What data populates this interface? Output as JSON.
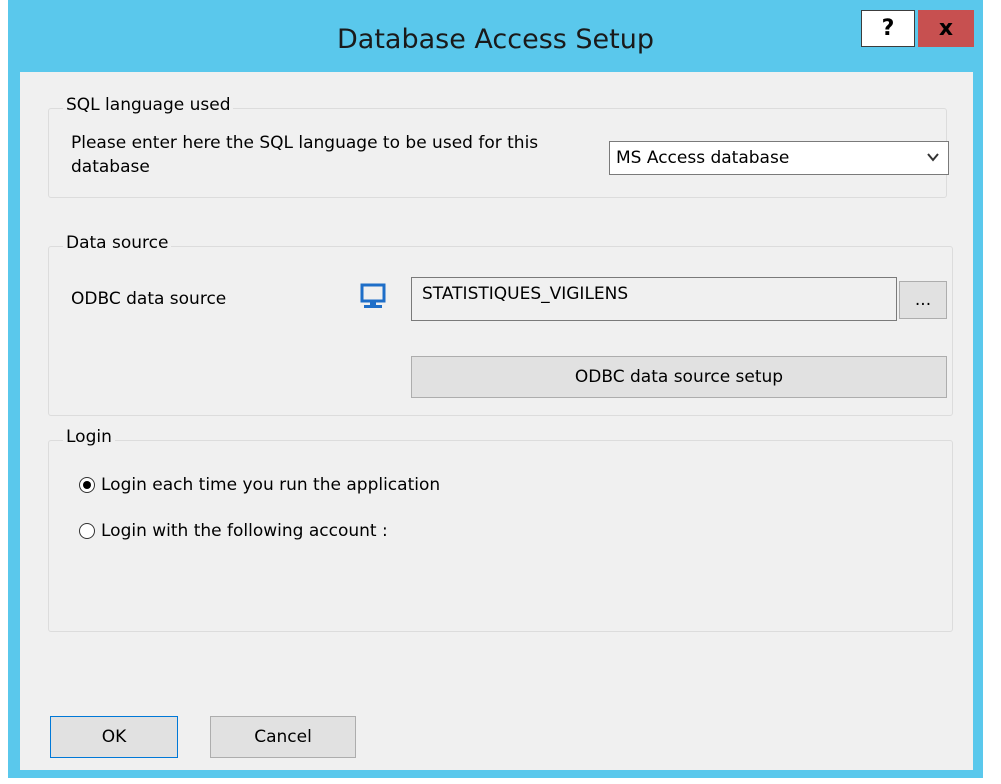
{
  "window": {
    "title": "Database Access Setup",
    "help_label": "?",
    "close_label": "x"
  },
  "sql_group": {
    "title": "SQL language used",
    "prompt": "Please enter here the SQL language to be used for this database",
    "selected": "MS Access database"
  },
  "data_source": {
    "title": "Data source",
    "odbc_label": "ODBC data source",
    "odbc_value": "STATISTIQUES_VIGILENS",
    "browse_label": "...",
    "setup_button": "ODBC data source setup"
  },
  "login": {
    "title": "Login",
    "options": [
      {
        "label": "Login each time you run the application",
        "checked": true
      },
      {
        "label": "Login with the following account :",
        "checked": false
      }
    ]
  },
  "footer": {
    "ok_label": "OK",
    "cancel_label": "Cancel"
  },
  "colors": {
    "title_bar": "#5ac8ec",
    "close_button": "#c75050",
    "dialog_bg": "#f0f0f0",
    "computer_icon": "#1e6ec8"
  },
  "icons": {
    "datasource": "computer-monitor-icon",
    "dropdown": "chevron-down-icon"
  }
}
